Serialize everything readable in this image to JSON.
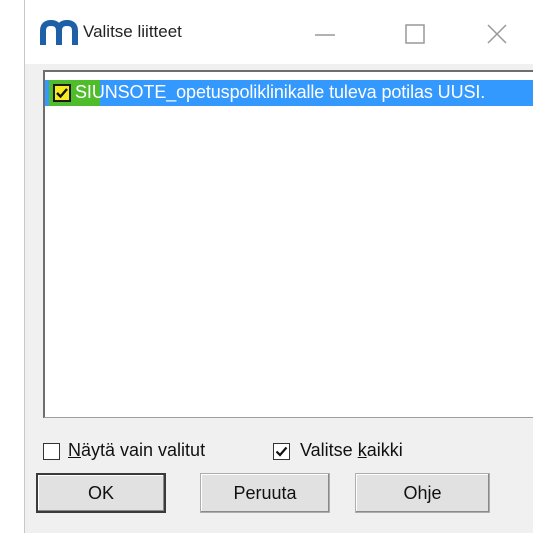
{
  "window": {
    "title": "Valitse liitteet",
    "app_icon": "m-logo-icon",
    "controls": [
      "minimize-icon",
      "maximize-icon",
      "close-icon"
    ]
  },
  "list": {
    "items": [
      {
        "checked": true,
        "highlight_prefix": "SI",
        "rest": "UNSOTE_opetuspoliklinikalle tuleva potilas UUSI."
      }
    ]
  },
  "options": {
    "only_selected": {
      "checked": false,
      "label_pre": "",
      "label_key": "N",
      "label_post": "äytä vain valitut"
    },
    "select_all": {
      "checked": true,
      "label_pre": "Valitse ",
      "label_key": "k",
      "label_post": "aikki"
    }
  },
  "buttons": {
    "ok": "OK",
    "cancel": "Peruuta",
    "help": "Ohje"
  },
  "colors": {
    "selection": "#3399ff",
    "highlight_green": "#4fbd2b",
    "checkbox_yellow": "#f5eb1f",
    "logo_blue": "#1e5fa8"
  }
}
